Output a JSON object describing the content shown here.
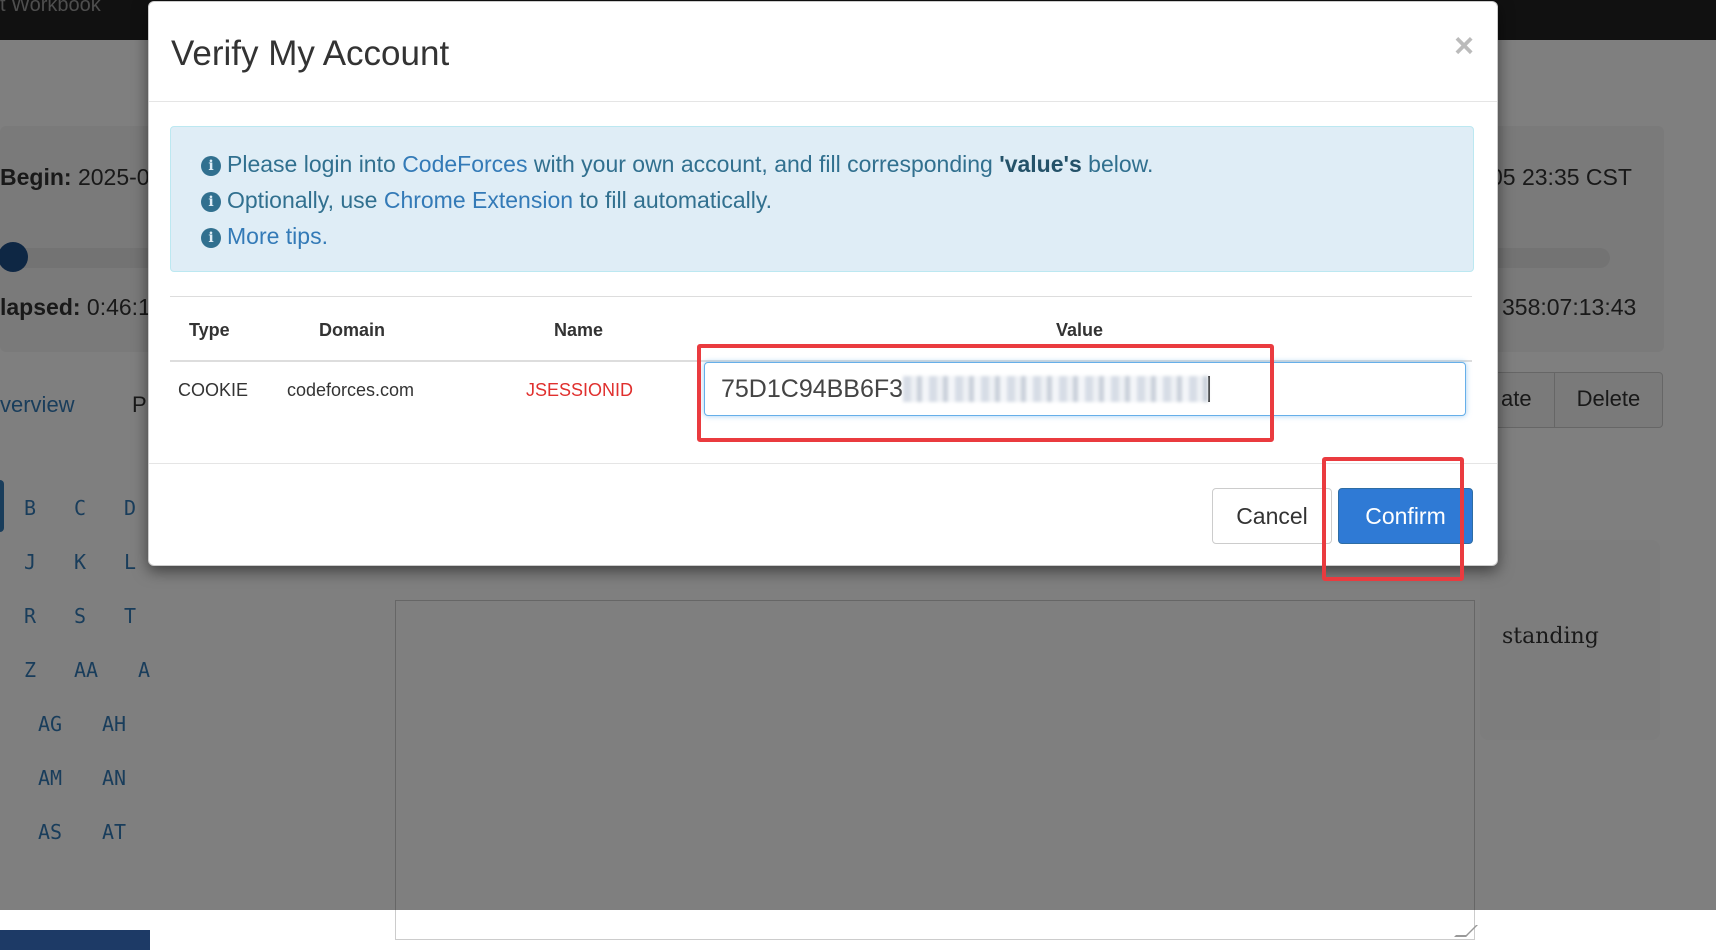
{
  "background": {
    "topbar_text": "t   Workbook",
    "begin_label": "Begin:",
    "begin_value": "2025-04",
    "end_partial": "05 23:35 CST",
    "elapsed_label": "lapsed:",
    "elapsed_value": "0:46:1",
    "remaining_partial": "358:07:13:43",
    "tab_overview": "verview",
    "tab_partial": "P",
    "group_buttons": [
      "ate",
      "Delete"
    ],
    "problem_letters": [
      [
        "B",
        "C",
        "D"
      ],
      [
        "J",
        "K",
        "L"
      ],
      [
        "R",
        "S",
        "T"
      ],
      [
        "Z",
        "AA",
        "A"
      ],
      [
        "AG",
        "AH"
      ],
      [
        "AM",
        "AN"
      ],
      [
        "AS",
        "AT"
      ]
    ],
    "standing_text": "standing"
  },
  "modal": {
    "title": "Verify My Account",
    "close_symbol": "×",
    "alert": {
      "line1_prefix": "Please login into",
      "line1_link": "CodeForces",
      "line1_middle": "with your own account, and fill corresponding",
      "line1_bold": "'value's",
      "line1_suffix": "below.",
      "line2_prefix": "Optionally, use",
      "line2_link": "Chrome Extension",
      "line2_suffix": "to fill automatically.",
      "line3_link": "More tips."
    },
    "table": {
      "headers": [
        "Type",
        "Domain",
        "Name",
        "Value"
      ],
      "row": {
        "type": "COOKIE",
        "domain": "codeforces.com",
        "name": "JSESSIONID",
        "value_visible": "75D1C94BB6F3"
      }
    },
    "buttons": {
      "cancel": "Cancel",
      "confirm": "Confirm"
    }
  },
  "colors": {
    "primary": "#2f7ad5",
    "annotation": "#ea3b3f",
    "alert_bg": "#dfedf6",
    "alert_text": "#31708f",
    "name_red": "#e0302e"
  }
}
